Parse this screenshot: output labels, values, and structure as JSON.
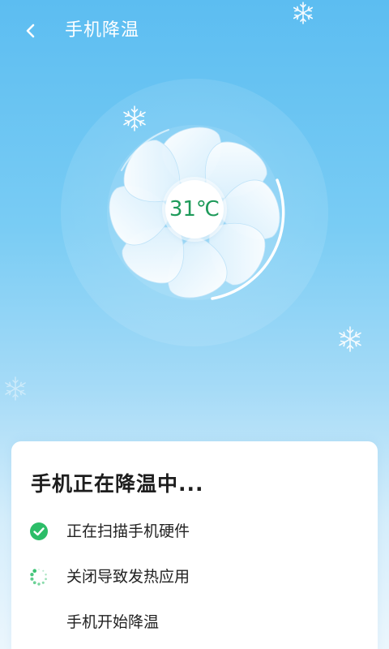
{
  "header": {
    "title": "手机降温",
    "back_icon": "chevron-left-icon"
  },
  "fan": {
    "temperature": "31℃",
    "icon": "fan-icon"
  },
  "status_card": {
    "title": "手机正在降温中...",
    "steps": [
      {
        "label": "正在扫描手机硬件",
        "state": "done",
        "icon": "check-circle-icon"
      },
      {
        "label": "关闭导致发热应用",
        "state": "in-progress",
        "icon": "loading-spinner-icon"
      },
      {
        "label": "手机开始降温",
        "state": "pending"
      }
    ]
  },
  "colors": {
    "accent_green": "#2cbd68",
    "temperature_text": "#1e9a5a",
    "background_top": "#5cbdf1",
    "background_bottom": "#ebf6fd",
    "card_background": "#ffffff"
  }
}
